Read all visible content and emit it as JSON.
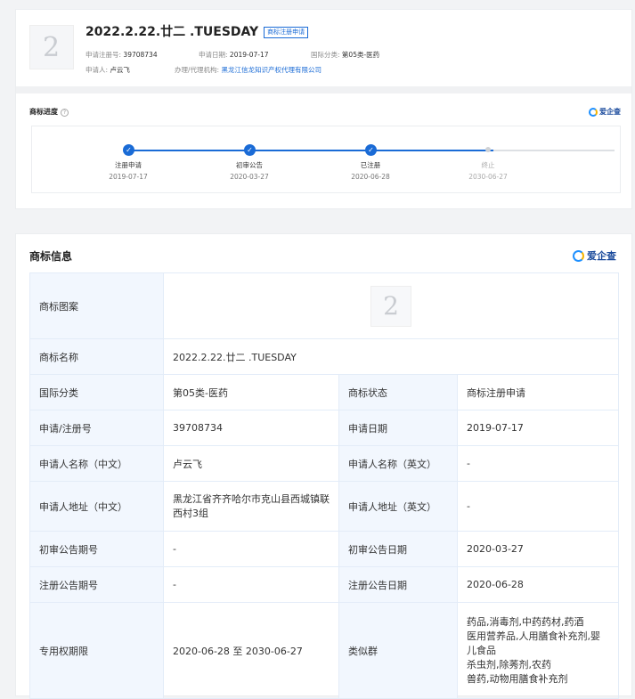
{
  "header": {
    "title": "2022.2.22.廿二 .TUESDAY",
    "badge": "商标注册申请",
    "logo_glyph": "2",
    "reg_no_label": "申请注册号:",
    "reg_no": "39708734",
    "apply_date_label": "申请日期:",
    "apply_date": "2019-07-17",
    "class_label": "国际分类:",
    "class_value": "第05类-医药",
    "applicant_label": "申请人:",
    "applicant": "卢云飞",
    "agency_label": "办理/代理机构:",
    "agency": "黑龙江信龙知识产权代理有限公司"
  },
  "progress": {
    "title": "商标进度",
    "help_glyph": "?",
    "brand": "爱企查",
    "steps": [
      {
        "label": "注册申请",
        "date": "2019-07-17",
        "done": true
      },
      {
        "label": "初审公告",
        "date": "2020-03-27",
        "done": true
      },
      {
        "label": "已注册",
        "date": "2020-06-28",
        "done": true
      },
      {
        "label": "终止",
        "date": "2030-06-27",
        "done": false
      }
    ]
  },
  "info": {
    "title": "商标信息",
    "brand": "爱企查",
    "image_label": "商标图案",
    "image_glyph": "2",
    "name_label": "商标名称",
    "name_value": "2022.2.22.廿二 .TUESDAY",
    "class_label": "国际分类",
    "class_value": "第05类-医药",
    "status_label": "商标状态",
    "status_value": "商标注册申请",
    "regno_label": "申请/注册号",
    "regno_value": "39708734",
    "apply_date_label": "申请日期",
    "apply_date_value": "2019-07-17",
    "applicant_cn_label": "申请人名称（中文）",
    "applicant_cn_value": "卢云飞",
    "applicant_en_label": "申请人名称（英文）",
    "applicant_en_value": "-",
    "address_cn_label": "申请人地址（中文）",
    "address_cn_value": "黑龙江省齐齐哈尔市克山县西城镇联西村3组",
    "address_en_label": "申请人地址（英文）",
    "address_en_value": "-",
    "prelim_no_label": "初审公告期号",
    "prelim_no_value": "-",
    "prelim_date_label": "初审公告日期",
    "prelim_date_value": "2020-03-27",
    "reg_pub_no_label": "注册公告期号",
    "reg_pub_no_value": "-",
    "reg_pub_date_label": "注册公告日期",
    "reg_pub_date_value": "2020-06-28",
    "term_label": "专用权期限",
    "term_value": "2020-06-28 至 2030-06-27",
    "similar_label": "类似群",
    "similar_lines": [
      "药品,消毒剂,中药药材,药酒",
      "医用营养品,人用膳食补充剂,婴儿食品",
      "杀虫剂,除莠剂,农药",
      "兽药,动物用膳食补充剂"
    ]
  },
  "colors": {
    "accent": "#1a6bd6",
    "header_cell": "#f2f7fe"
  }
}
